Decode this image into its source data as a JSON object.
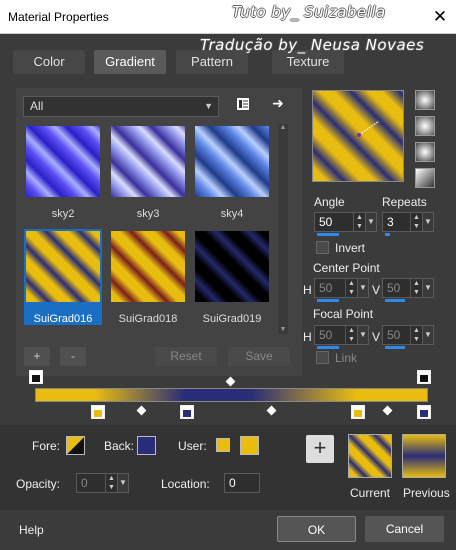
{
  "window": {
    "title": "Material Properties",
    "close_glyph": "✕"
  },
  "watermark": {
    "line1": "Tuto by_ Suizabella",
    "line2": "Tradução by_ Neusa Novaes"
  },
  "tabs": [
    "Color",
    "Gradient",
    "Pattern",
    "Texture"
  ],
  "active_tab": "Gradient",
  "library": {
    "category": "All",
    "items": [
      {
        "label": "sky2"
      },
      {
        "label": "sky3"
      },
      {
        "label": "sky4"
      },
      {
        "label": "SuiGrad016",
        "selected": true
      },
      {
        "label": "SuiGrad018"
      },
      {
        "label": "SuiGrad019"
      }
    ],
    "add_label": "+",
    "remove_label": "-",
    "reset_label": "Reset",
    "save_label": "Save"
  },
  "settings": {
    "angle_label": "Angle",
    "angle_value": "50",
    "repeats_label": "Repeats",
    "repeats_value": "3",
    "invert_label": "Invert",
    "center_point_label": "Center Point",
    "center_h_label": "H",
    "center_h": "50",
    "center_v_label": "V",
    "center_v": "50",
    "focal_point_label": "Focal Point",
    "focal_h_label": "H",
    "focal_h": "50",
    "focal_v_label": "V",
    "focal_v": "50",
    "link_label": "Link"
  },
  "colors": {
    "yellow": "#e8bd10",
    "navy": "#2a2d78",
    "accent": "#1a6fc4"
  },
  "bottom": {
    "fore_label": "Fore:",
    "back_label": "Back:",
    "user_label": "User:",
    "opacity_label": "Opacity:",
    "opacity_value": "0",
    "location_label": "Location:",
    "location_value": "0",
    "current_label": "Current",
    "previous_label": "Previous",
    "add_glyph": "+"
  },
  "footer": {
    "help": "Help",
    "ok": "OK",
    "cancel": "Cancel"
  }
}
